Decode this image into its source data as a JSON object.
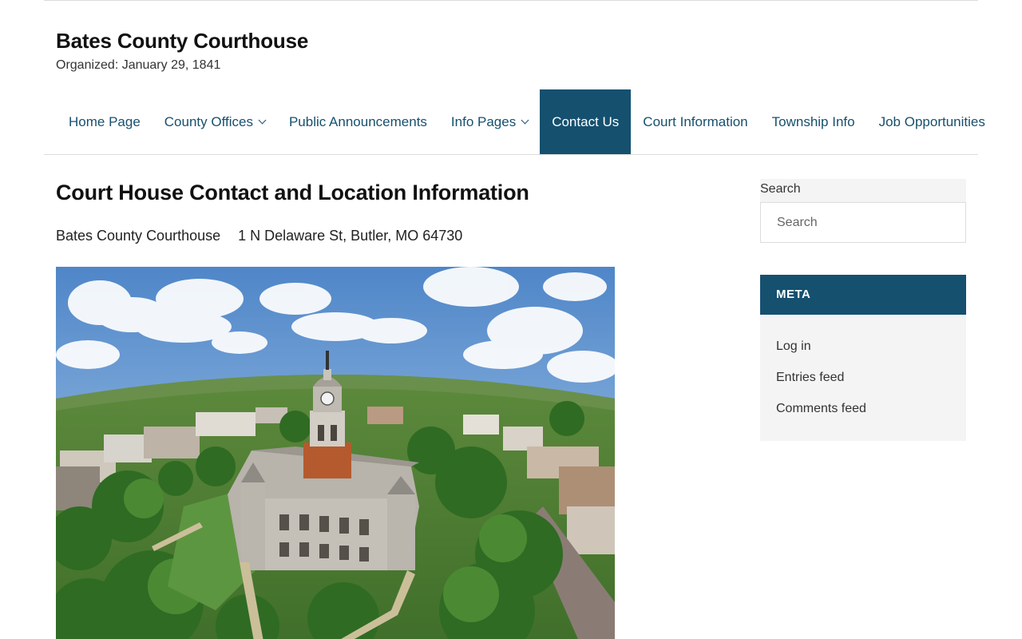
{
  "site": {
    "title": "Bates County Courthouse",
    "tagline": "Organized: January 29, 1841"
  },
  "nav": {
    "items": [
      {
        "label": "Home Page",
        "has_dropdown": false,
        "active": false
      },
      {
        "label": "County Offices",
        "has_dropdown": true,
        "active": false
      },
      {
        "label": "Public Announcements",
        "has_dropdown": false,
        "active": false
      },
      {
        "label": "Info Pages",
        "has_dropdown": true,
        "active": false
      },
      {
        "label": "Contact Us",
        "has_dropdown": false,
        "active": true
      },
      {
        "label": "Court Information",
        "has_dropdown": false,
        "active": false
      },
      {
        "label": "Township Info",
        "has_dropdown": false,
        "active": false
      },
      {
        "label": "Job Opportunities",
        "has_dropdown": false,
        "active": false
      }
    ]
  },
  "main": {
    "title": "Court House Contact and Location Information",
    "address_name": "Bates County Courthouse",
    "address": "1 N Delaware St, Butler, MO 64730"
  },
  "sidebar": {
    "search": {
      "label": "Search",
      "placeholder": "Search",
      "value": ""
    },
    "meta": {
      "heading": "META",
      "links": [
        "Log in",
        "Entries feed",
        "Comments feed"
      ]
    }
  },
  "colors": {
    "accent": "#15506f",
    "nav_text": "#17506e",
    "widget_bg": "#f4f4f4"
  },
  "icons": {
    "dropdown": "chevron-down-icon"
  }
}
